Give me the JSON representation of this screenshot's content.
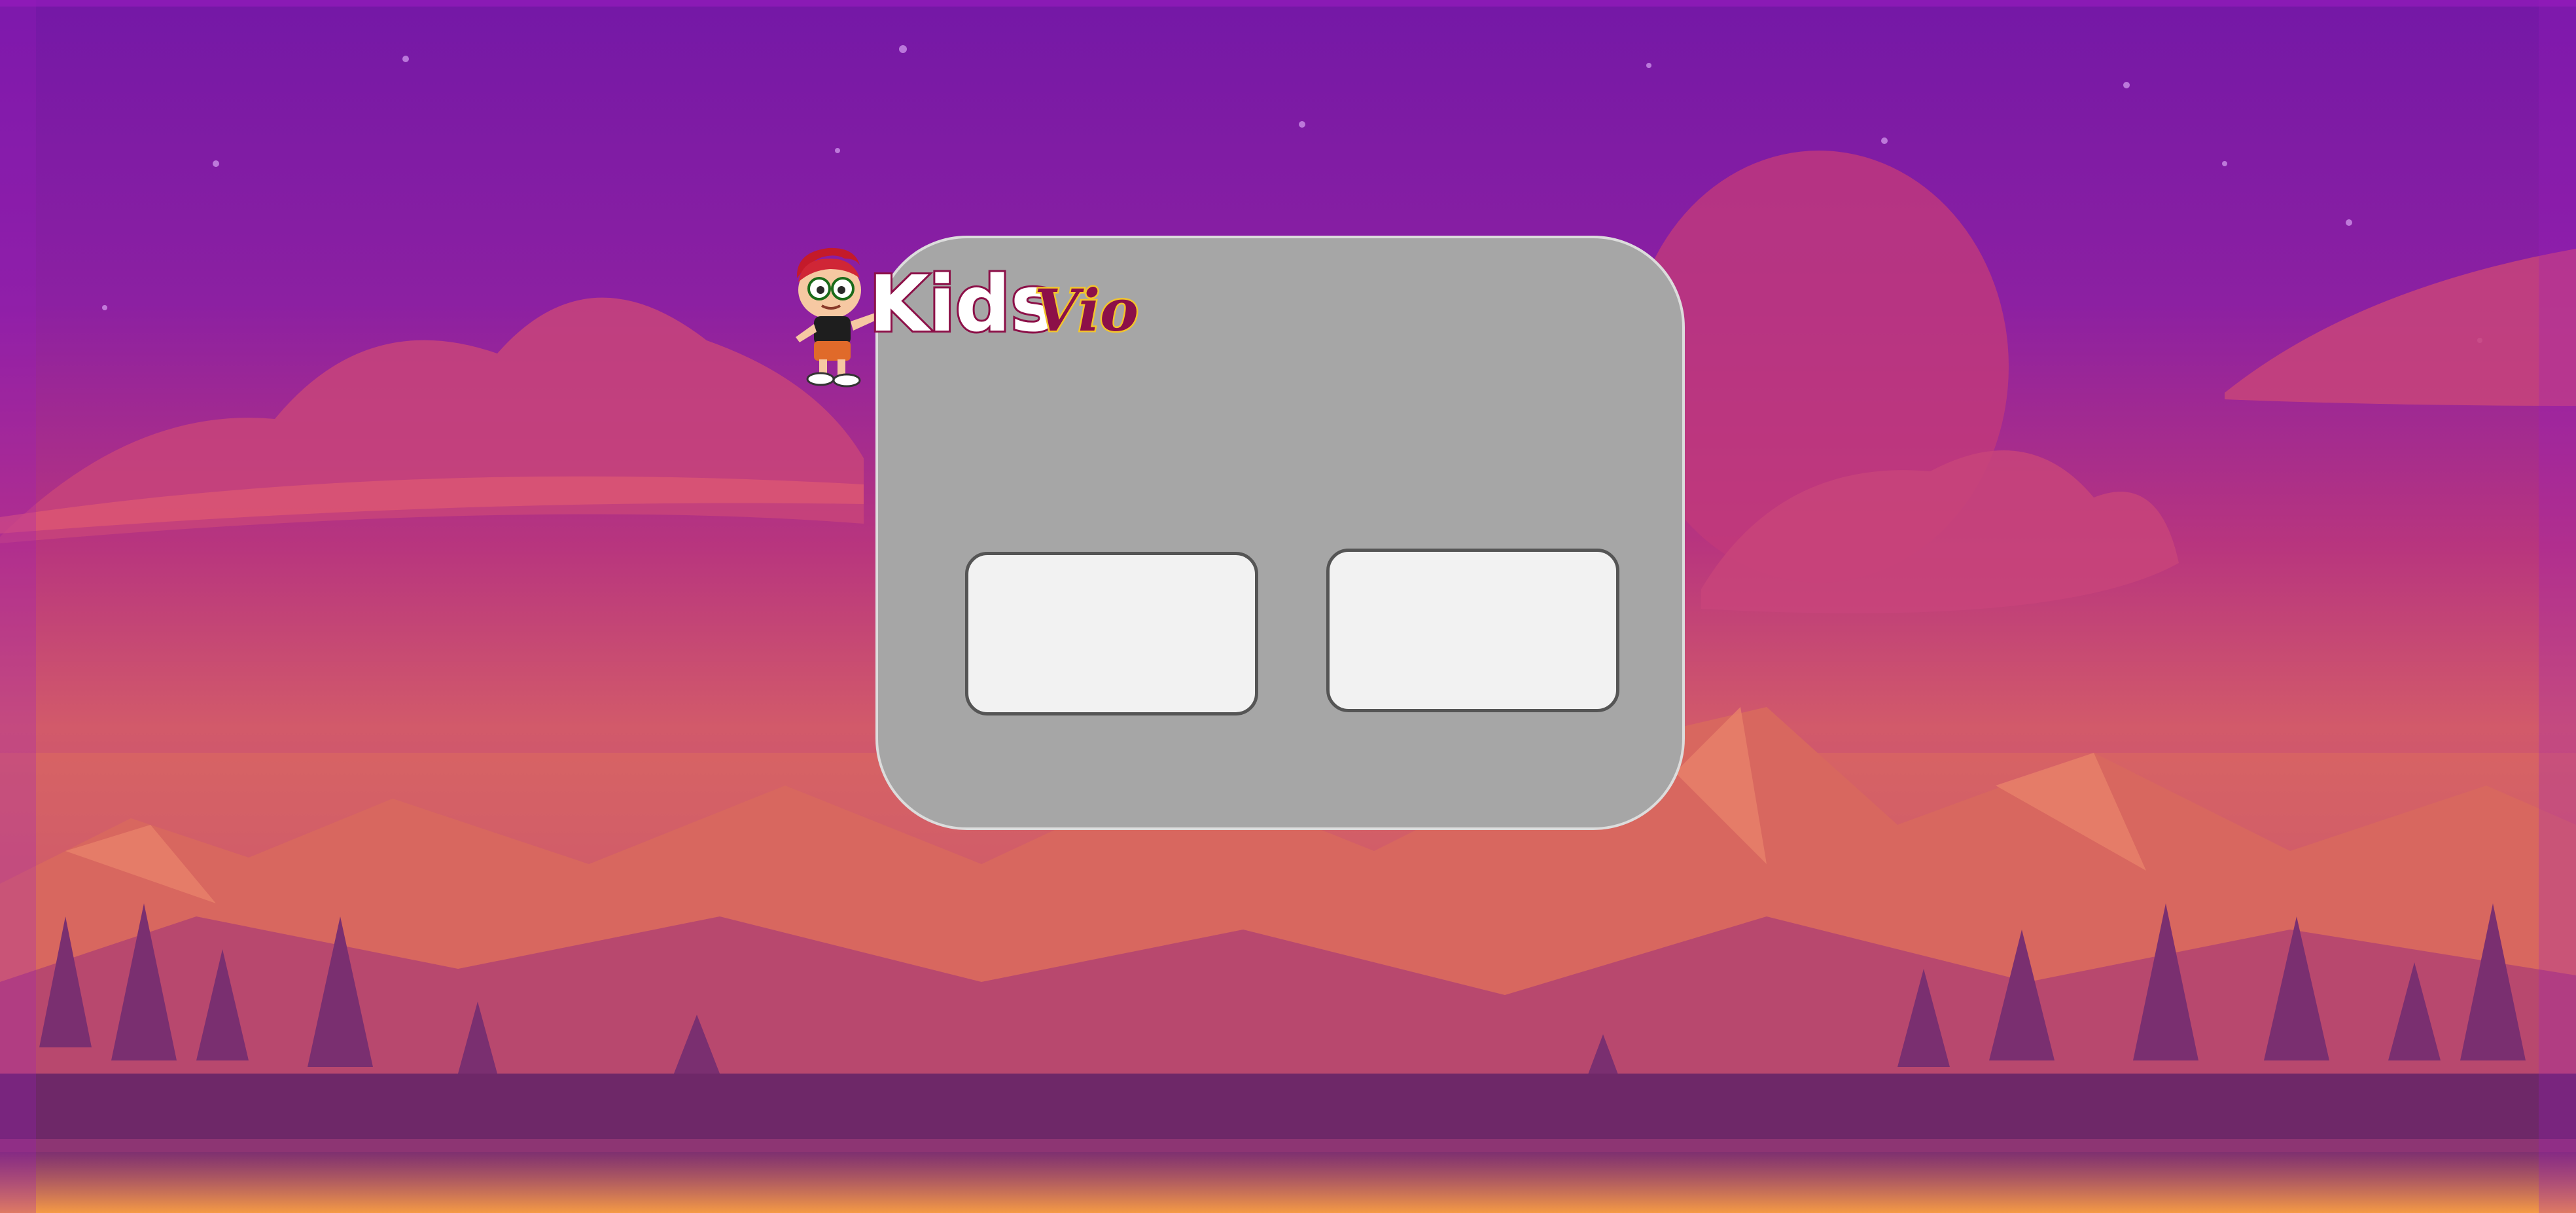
{
  "logo": {
    "brand_part1": "Kids",
    "brand_part2": "Vio"
  },
  "buttons": {
    "left_label": "",
    "right_label": ""
  },
  "colors": {
    "panel": "#a6a6a6",
    "button_fill": "#f2f2f2",
    "button_border": "#555555",
    "logo_pink": "#8c1048",
    "logo_yellow": "#f3c52b"
  }
}
